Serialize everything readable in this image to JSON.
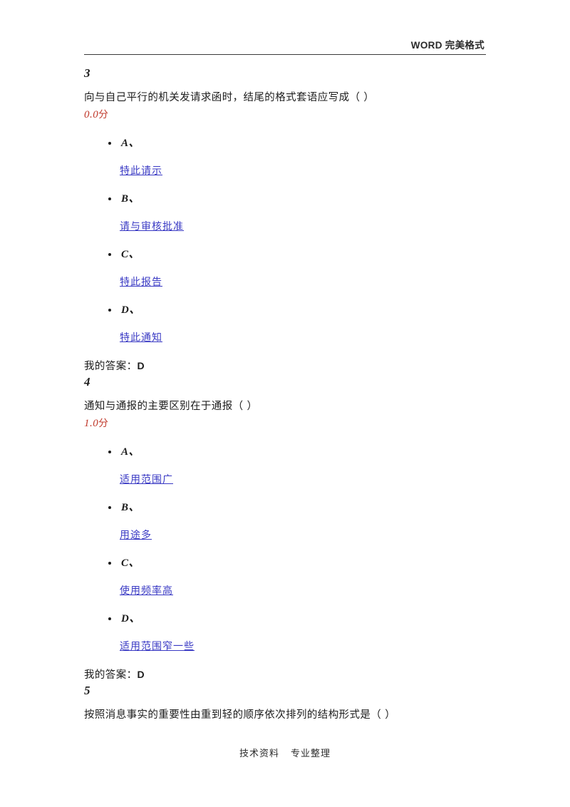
{
  "header": {
    "text": "WORD 完美格式"
  },
  "questions": [
    {
      "number": "3",
      "stem": "向与自己平行的机关发请求函时，结尾的格式套语应写成（ ）",
      "score_value": "0.0",
      "score_unit": "分",
      "options": [
        {
          "letter": "A、",
          "text": "特此请示"
        },
        {
          "letter": "B、",
          "text": "请与审核批准"
        },
        {
          "letter": "C、",
          "text": "特此报告"
        },
        {
          "letter": "D、",
          "text": "特此通知"
        }
      ],
      "answer_label": "我的答案：",
      "answer_value": "D"
    },
    {
      "number": "4",
      "stem": "通知与通报的主要区别在于通报（ ）",
      "score_value": "1.0",
      "score_unit": "分",
      "options": [
        {
          "letter": "A、",
          "text": "适用范围广"
        },
        {
          "letter": "B、",
          "text": "用途多"
        },
        {
          "letter": "C、",
          "text": "使用频率高"
        },
        {
          "letter": "D、",
          "text": "适用范围窄一些"
        }
      ],
      "answer_label": "我的答案：",
      "answer_value": "D"
    },
    {
      "number": "5",
      "stem": "按照消息事实的重要性由重到轻的顺序依次排列的结构形式是（ ）",
      "score_value": null,
      "score_unit": null,
      "options": [],
      "answer_label": null,
      "answer_value": null
    }
  ],
  "footer": {
    "left_text": "技术资料",
    "right_text": "专业整理"
  },
  "colors": {
    "link": "#3a3ac4",
    "score": "#c0392b",
    "text": "#1c1c1c"
  }
}
